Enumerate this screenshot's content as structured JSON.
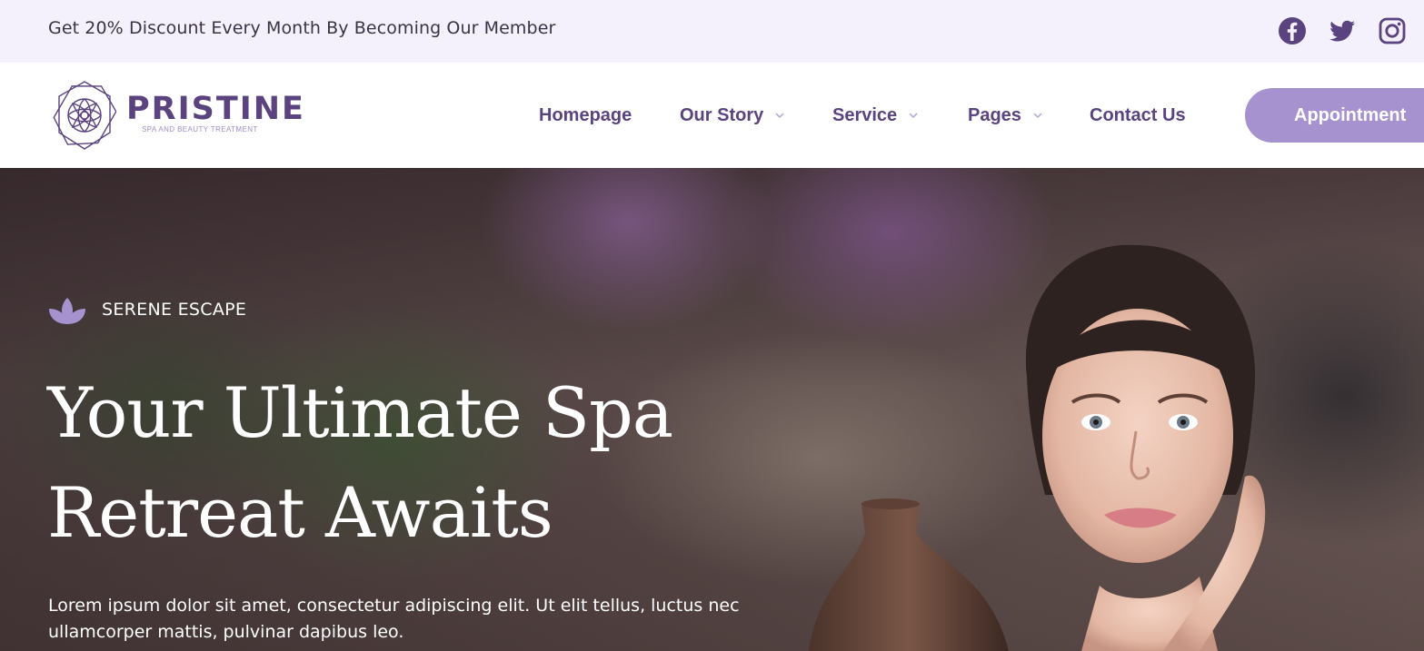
{
  "topbar": {
    "promo_text": "Get 20% Discount Every Month By Becoming Our Member",
    "social": [
      "facebook-icon",
      "twitter-icon",
      "instagram-icon"
    ]
  },
  "logo": {
    "name": "PRISTINE",
    "tagline": "SPA AND BEAUTY TREATMENT"
  },
  "nav": {
    "items": [
      {
        "label": "Homepage",
        "has_dropdown": false
      },
      {
        "label": "Our Story",
        "has_dropdown": true
      },
      {
        "label": "Service",
        "has_dropdown": true
      },
      {
        "label": "Pages",
        "has_dropdown": true
      },
      {
        "label": "Contact Us",
        "has_dropdown": false
      }
    ],
    "cta_label": "Appointment"
  },
  "hero": {
    "eyebrow": "SERENE ESCAPE",
    "title_line1": "Your Ultimate Spa",
    "title_line2": "Retreat Awaits",
    "description": "Lorem ipsum dolor sit amet, consectetur adipiscing elit. Ut elit tellus, luctus nec ullamcorper mattis, pulvinar dapibus leo."
  },
  "colors": {
    "brand": "#5a437f",
    "accent": "#a592cf",
    "topbar_bg": "#f5f1fc"
  }
}
